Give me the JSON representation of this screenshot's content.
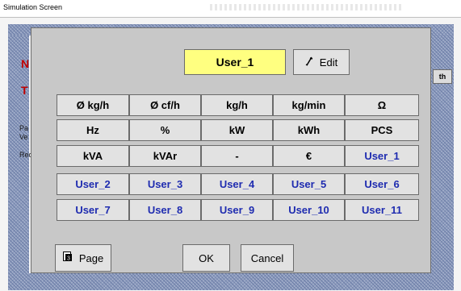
{
  "window": {
    "title": "Simulation Screen"
  },
  "background": {
    "label_n": "N",
    "label_t": "T",
    "label_pa": "Pa",
    "label_ve": "Ve",
    "label_rec": "Rec",
    "tab_partial": "th"
  },
  "current_unit": "User_1",
  "edit_label": "Edit",
  "units": [
    [
      "Ø kg/h",
      "Ø cf/h",
      "kg/h",
      "kg/min",
      "Ω"
    ],
    [
      "Hz",
      "%",
      "kW",
      "kWh",
      "PCS"
    ],
    [
      "kVA",
      "kVAr",
      "-",
      "€",
      "User_1"
    ],
    [
      "User_2",
      "User_3",
      "User_4",
      "User_5",
      "User_6"
    ],
    [
      "User_7",
      "User_8",
      "User_9",
      "User_10",
      "User_11"
    ]
  ],
  "page_label": "Page",
  "ok_label": "OK",
  "cancel_label": "Cancel",
  "colors": {
    "user_text": "#1f2cb0",
    "highlight": "#ffff80",
    "hatch": "#8c9bbd"
  },
  "icons": {
    "edit": "pencil-icon",
    "page": "page-icon"
  }
}
